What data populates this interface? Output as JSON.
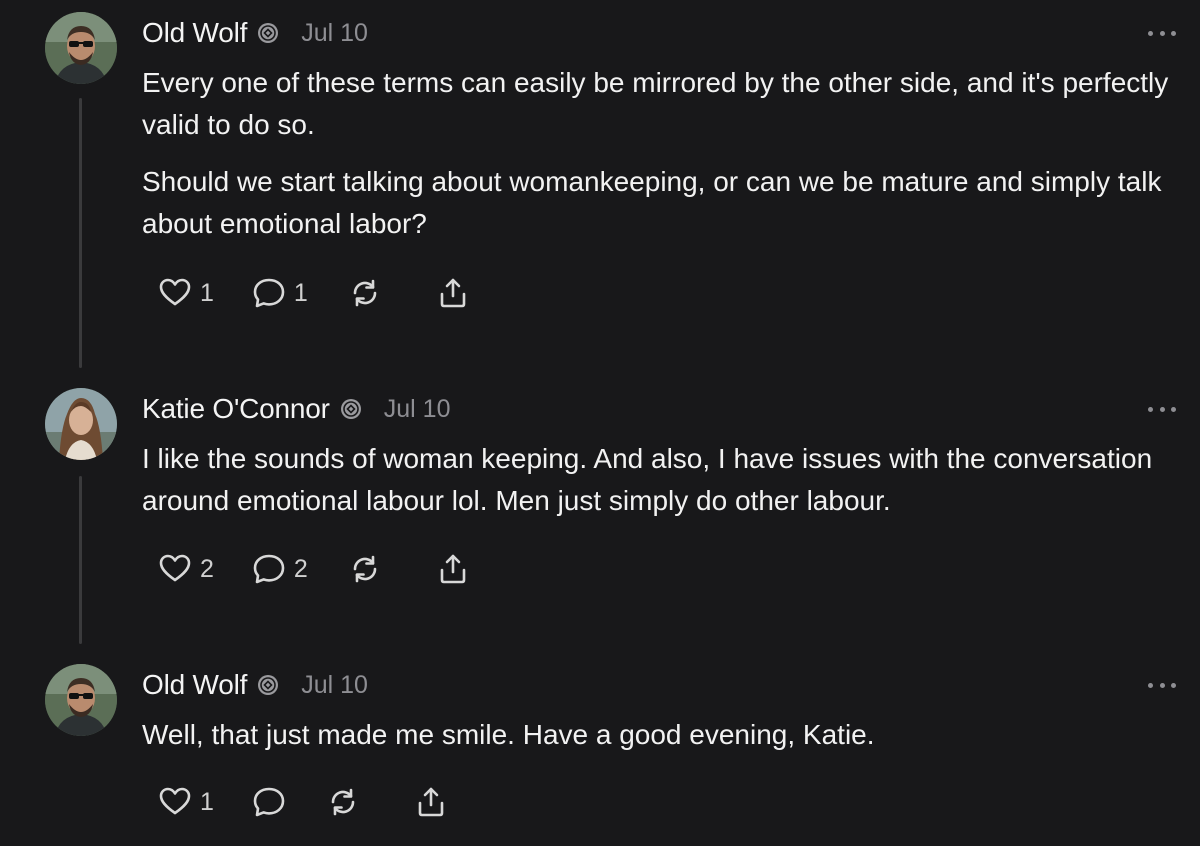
{
  "posts": [
    {
      "author": "Old Wolf",
      "date": "Jul 10",
      "paragraphs": [
        "Every one of these terms can easily be mirrored by the other side, and it's perfectly valid to do so.",
        "Should we start talking about womankeeping, or can we be mature and simply talk about emotional labor?"
      ],
      "likes": "1",
      "replies": "1"
    },
    {
      "author": "Katie O'Connor",
      "date": "Jul 10",
      "paragraphs": [
        "I like the sounds of woman keeping. And also, I have issues with the conversation around emotional labour lol. Men just simply do other labour."
      ],
      "likes": "2",
      "replies": "2"
    },
    {
      "author": "Old Wolf",
      "date": "Jul 10",
      "paragraphs": [
        "Well, that just made me smile. Have a good evening, Katie."
      ],
      "likes": "1",
      "replies": ""
    }
  ],
  "icons": {
    "badge": "verified-badge-icon",
    "like": "heart-icon",
    "reply": "comment-icon",
    "repost": "repost-icon",
    "share": "share-icon",
    "more": "more-options-icon"
  },
  "colors": {
    "background": "#18181a",
    "text": "#f2f2f2",
    "muted": "#8e8e93",
    "thread_line": "#3a3a3c"
  }
}
